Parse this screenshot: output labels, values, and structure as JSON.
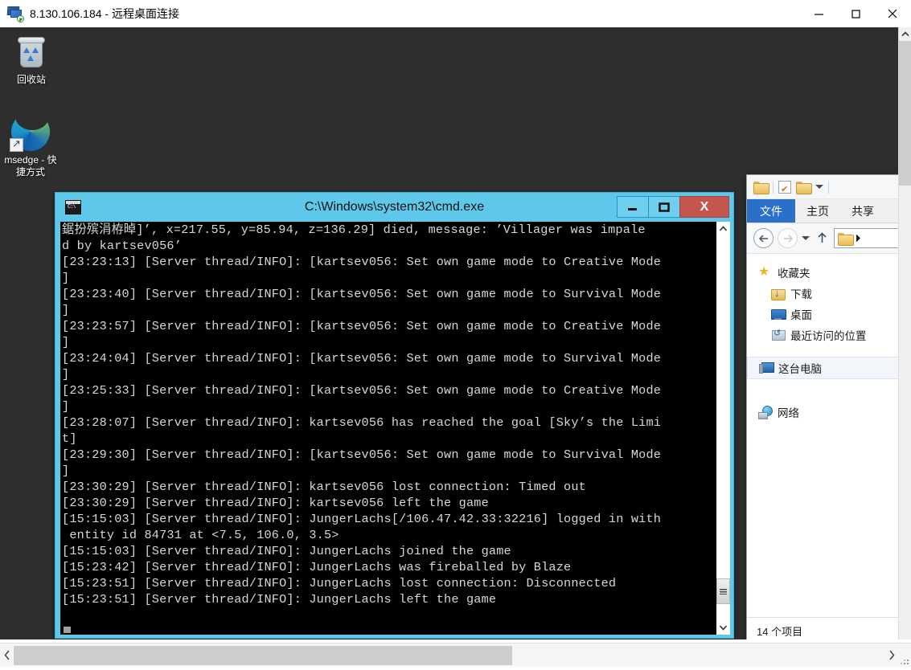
{
  "rdp": {
    "title": "8.130.106.184 - 远程桌面连接",
    "icon": "remote-desktop-icon",
    "controls": {
      "minimize": "minimize-icon",
      "maximize": "maximize-icon",
      "close": "close-icon"
    }
  },
  "desktop": {
    "background_color": "#2e2e2e",
    "icons": [
      {
        "name": "recycle-bin",
        "label": "回收站"
      },
      {
        "name": "msedge-shortcut",
        "label": "msedge - 快捷方式"
      }
    ]
  },
  "cmd_window": {
    "title": "C:\\Windows\\system32\\cmd.exe",
    "titlebar_color": "#5ec8ea",
    "close_button_color": "#c5554f",
    "buttons": {
      "minimize": "_",
      "maximize": "□",
      "close": "X"
    },
    "console_text": "鋸扮殡涓栫晫]’, x=217.55, y=85.94, z=136.29] died, message: ’Villager was impale\nd by kartsev056’\n[23:23:13] [Server thread/INFO]: [kartsev056: Set own game mode to Creative Mode\n]\n[23:23:40] [Server thread/INFO]: [kartsev056: Set own game mode to Survival Mode\n]\n[23:23:57] [Server thread/INFO]: [kartsev056: Set own game mode to Creative Mode\n]\n[23:24:04] [Server thread/INFO]: [kartsev056: Set own game mode to Survival Mode\n]\n[23:25:33] [Server thread/INFO]: [kartsev056: Set own game mode to Creative Mode\n]\n[23:28:07] [Server thread/INFO]: kartsev056 has reached the goal [Sky’s the Limi\nt]\n[23:29:30] [Server thread/INFO]: [kartsev056: Set own game mode to Survival Mode\n]\n[23:30:29] [Server thread/INFO]: kartsev056 lost connection: Timed out\n[23:30:29] [Server thread/INFO]: kartsev056 left the game\n[15:15:03] [Server thread/INFO]: JungerLachs[/106.47.42.33:32216] logged in with\n entity id 84731 at <7.5, 106.0, 3.5>\n[15:15:03] [Server thread/INFO]: JungerLachs joined the game\n[15:23:42] [Server thread/INFO]: JungerLachs was fireballed by Blaze\n[15:23:51] [Server thread/INFO]: JungerLachs lost connection: Disconnected\n[15:23:51] [Server thread/INFO]: JungerLachs left the game"
  },
  "explorer": {
    "quick_access": [
      {
        "name": "folder-icon",
        "label": ""
      },
      {
        "name": "properties-icon",
        "label": ""
      },
      {
        "name": "new-folder-icon",
        "label": ""
      },
      {
        "name": "customize-dropdown-icon",
        "label": ""
      }
    ],
    "ribbon_tabs": [
      {
        "name": "tab-file",
        "label": "文件",
        "selected": true
      },
      {
        "name": "tab-home",
        "label": "主页",
        "selected": false
      },
      {
        "name": "tab-share",
        "label": "共享",
        "selected": false
      }
    ],
    "nav_buttons": {
      "back": "←",
      "forward": "→",
      "recent": "recent-locations-icon",
      "up": "↑"
    },
    "address_value": "",
    "nav_pane": [
      {
        "name": "favorites",
        "label": "收藏夹",
        "icon": "star-icon",
        "level": 0
      },
      {
        "name": "downloads",
        "label": "下载",
        "icon": "downloads-folder-icon",
        "level": 1
      },
      {
        "name": "desktop",
        "label": "桌面",
        "icon": "desktop-icon",
        "level": 1
      },
      {
        "name": "recent-places",
        "label": "最近访问的位置",
        "icon": "recent-places-icon",
        "level": 1
      },
      {
        "name": "this-pc",
        "label": "这台电脑",
        "icon": "computer-icon",
        "level": 0,
        "selected": true
      },
      {
        "name": "network",
        "label": "网络",
        "icon": "network-icon",
        "level": 0
      }
    ],
    "status_text": "14 个项目"
  },
  "scrollbars": {
    "vertical_up": "∧",
    "vertical_down": "∨",
    "horizontal_left": "⟨",
    "horizontal_right": "⟩"
  }
}
